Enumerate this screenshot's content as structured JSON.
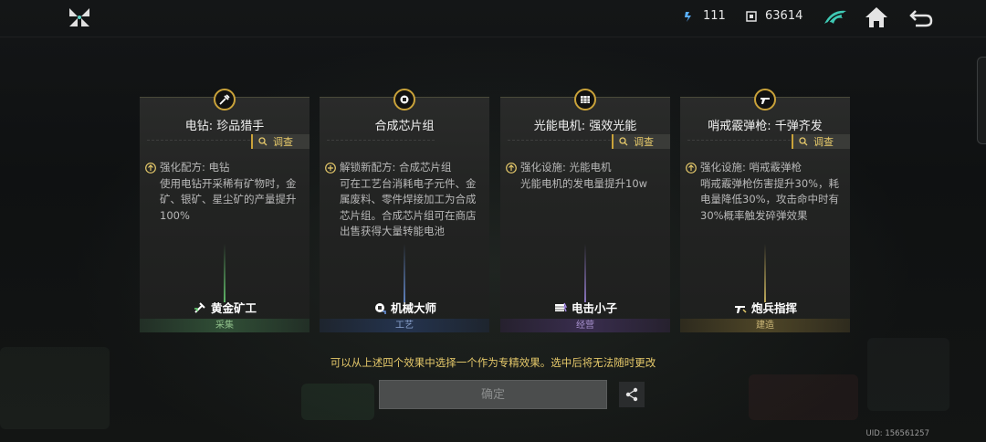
{
  "topbar": {
    "energy": "111",
    "chips": "63614",
    "icons": [
      "app-logo-icon",
      "energy-icon",
      "chip-icon",
      "wing-icon",
      "home-icon",
      "back-icon"
    ]
  },
  "cards": [
    {
      "title": "电钻: 珍品猎手",
      "investigate": "调查",
      "desc_head": "强化配方: 电钻",
      "desc_body": "使用电钻开采稀有矿物时，金矿、银矿、星尘矿的产量提升100%",
      "role": "黄金矿工",
      "category": "采集",
      "accent": "#6fdc7a"
    },
    {
      "title": "合成芯片组",
      "investigate": "调查",
      "desc_head": "解锁新配方: 合成芯片组",
      "desc_body": "可在工艺台消耗电子元件、金属废料、零件焊接加工为合成芯片组。合成芯片组可在商店出售获得大量转能电池",
      "role": "机械大师",
      "category": "工艺",
      "accent": "#6f9ae6"
    },
    {
      "title": "光能电机: 强效光能",
      "investigate": "调查",
      "desc_head": "强化设施: 光能电机",
      "desc_body": "光能电机的发电量提升10w",
      "role": "电击小子",
      "category": "经营",
      "accent": "#a58ae6"
    },
    {
      "title": "哨戒霰弹枪: 千弹齐发",
      "investigate": "调查",
      "desc_head": "强化设施: 哨戒霰弹枪",
      "desc_body": "哨戒霰弹枪伤害提升30%，耗电量降低30%，攻击命中时有30%概率触发碎弹效果",
      "role": "炮兵指挥",
      "category": "建造",
      "accent": "#e6cc6a"
    }
  ],
  "notice": "可以从上述四个效果中选择一个作为专精效果。选中后将无法随时更改",
  "confirm_label": "确定",
  "uid": "UID: 156561257",
  "colors": {
    "gold": "#c9a23a",
    "text_gold": "#e6c96a"
  }
}
